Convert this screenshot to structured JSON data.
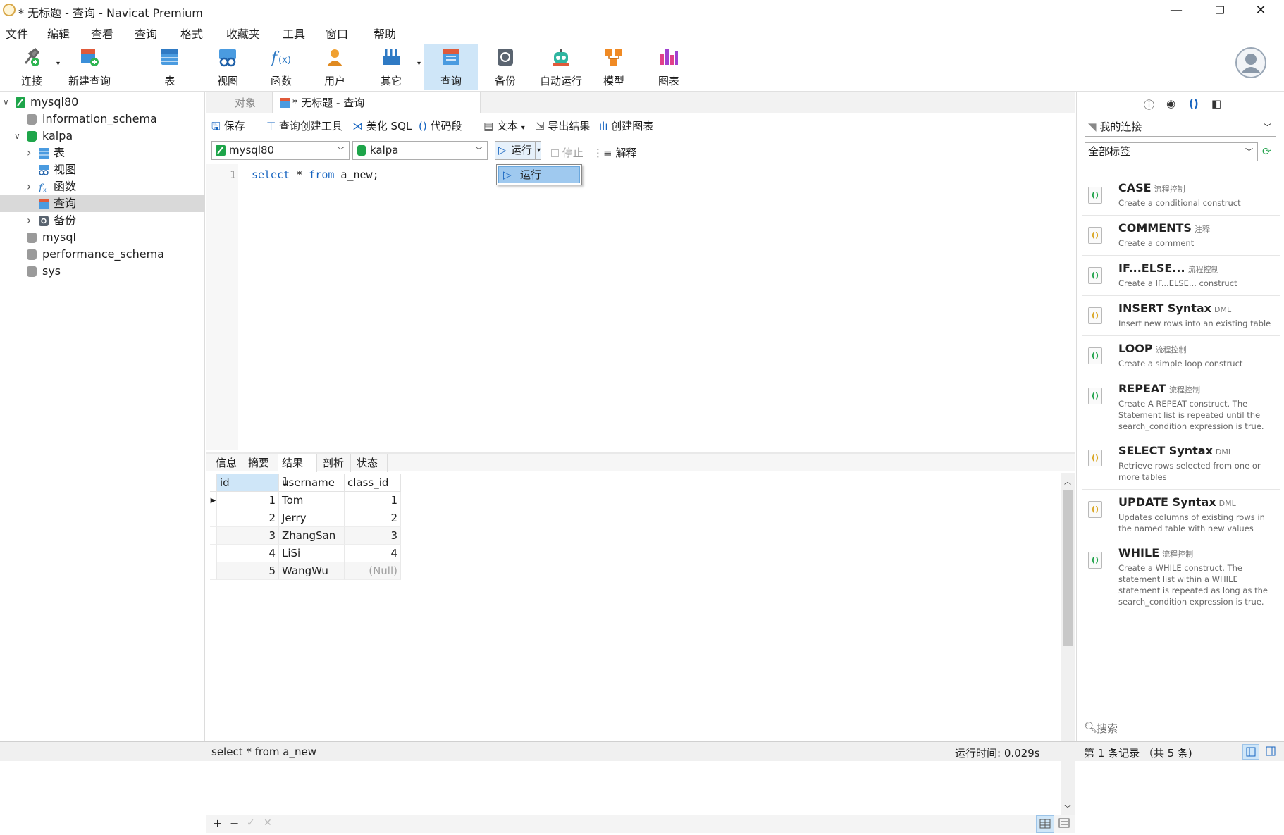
{
  "window": {
    "title": "* 无标题 - 查询 - Navicat Premium",
    "min": "—",
    "restore": "❐",
    "close": "✕"
  },
  "menu": [
    "文件",
    "编辑",
    "查看",
    "查询",
    "格式",
    "收藏夹",
    "工具",
    "窗口",
    "帮助"
  ],
  "toolbar": [
    {
      "label": "连接",
      "icon": "connection-icon"
    },
    {
      "label": "新建查询",
      "icon": "new-query-icon"
    },
    {
      "label": "表",
      "icon": "table-icon"
    },
    {
      "label": "视图",
      "icon": "view-icon"
    },
    {
      "label": "函数",
      "icon": "function-icon"
    },
    {
      "label": "用户",
      "icon": "user-icon"
    },
    {
      "label": "其它",
      "icon": "other-icon"
    },
    {
      "label": "查询",
      "icon": "query-icon"
    },
    {
      "label": "备份",
      "icon": "backup-icon"
    },
    {
      "label": "自动运行",
      "icon": "automation-icon"
    },
    {
      "label": "模型",
      "icon": "model-icon"
    },
    {
      "label": "图表",
      "icon": "chart-icon"
    }
  ],
  "tree": [
    {
      "label": "mysql80",
      "level": 0,
      "arrow": "∨",
      "icon": "connection"
    },
    {
      "label": "information_schema",
      "level": 1,
      "arrow": "",
      "icon": "db"
    },
    {
      "label": "kalpa",
      "level": 1,
      "arrow": "∨",
      "icon": "db-green"
    },
    {
      "label": "表",
      "level": 2,
      "arrow": "›",
      "icon": "table"
    },
    {
      "label": "视图",
      "level": 2,
      "arrow": "",
      "icon": "view"
    },
    {
      "label": "函数",
      "level": 2,
      "arrow": "›",
      "icon": "function"
    },
    {
      "label": "查询",
      "level": 2,
      "arrow": "",
      "icon": "query",
      "selected": true
    },
    {
      "label": "备份",
      "level": 2,
      "arrow": "›",
      "icon": "backup"
    },
    {
      "label": "mysql",
      "level": 1,
      "arrow": "",
      "icon": "db"
    },
    {
      "label": "performance_schema",
      "level": 1,
      "arrow": "",
      "icon": "db"
    },
    {
      "label": "sys",
      "level": 1,
      "arrow": "",
      "icon": "db"
    }
  ],
  "tabs": {
    "objects": "对象",
    "query": "* 无标题 - 查询"
  },
  "query_tools": {
    "save": "保存",
    "builder": "查询创建工具",
    "beautify": "美化 SQL",
    "snippet": "代码段",
    "text": "文本",
    "export": "导出结果",
    "chart": "创建图表"
  },
  "selectors": {
    "connection": "mysql80",
    "database": "kalpa",
    "run": "运行",
    "stop": "停止",
    "explain": "解释"
  },
  "editor": {
    "line": "1",
    "kw1": "select",
    "rest1": " * ",
    "kw2": "from",
    "rest2": " a_new;"
  },
  "dropdown": {
    "item": "运行"
  },
  "result_tabs": [
    "信息",
    "摘要",
    "结果 1",
    "剖析",
    "状态"
  ],
  "grid": {
    "columns": [
      "id",
      "username",
      "class_id"
    ],
    "rows": [
      [
        "1",
        "Tom",
        "1"
      ],
      [
        "2",
        "Jerry",
        "2"
      ],
      [
        "3",
        "ZhangSan",
        "3"
      ],
      [
        "4",
        "LiSi",
        "4"
      ],
      [
        "5",
        "WangWu",
        "(Null)"
      ]
    ]
  },
  "grid_bar": {
    "add": "+",
    "remove": "−",
    "apply": "✓",
    "discard": "✕"
  },
  "status": {
    "sql": "select * from a_new",
    "time": "运行时间: 0.029s",
    "records": "第 1 条记录 （共 5 条)"
  },
  "right": {
    "connection": "我的连接",
    "tags": "全部标签",
    "search_placeholder": "搜索",
    "snippets": [
      {
        "name": "CASE",
        "cat": "流程控制",
        "desc": "Create a conditional construct"
      },
      {
        "name": "COMMENTS",
        "cat": "注释",
        "desc": "Create a comment"
      },
      {
        "name": "IF...ELSE...",
        "cat": "流程控制",
        "desc": "Create a IF...ELSE... construct"
      },
      {
        "name": "INSERT Syntax",
        "cat": "DML",
        "desc": "Insert new rows into an existing table"
      },
      {
        "name": "LOOP",
        "cat": "流程控制",
        "desc": "Create a simple loop construct"
      },
      {
        "name": "REPEAT",
        "cat": "流程控制",
        "desc": "Create A REPEAT construct. The Statement list is repeated until the search_condition expression is true."
      },
      {
        "name": "SELECT Syntax",
        "cat": "DML",
        "desc": "Retrieve rows selected from one or more tables"
      },
      {
        "name": "UPDATE Syntax",
        "cat": "DML",
        "desc": "Updates columns of existing rows in the named table with new values"
      },
      {
        "name": "WHILE",
        "cat": "流程控制",
        "desc": "Create a WHILE construct. The statement list within a WHILE statement is repeated as long as the search_condition expression is true."
      }
    ]
  },
  "colors": {
    "accent": "#1664c0",
    "active_tool": "#cfe6f8",
    "selected_tree": "#d9d9d9",
    "dropdown_hl": "#9fc9ef"
  }
}
